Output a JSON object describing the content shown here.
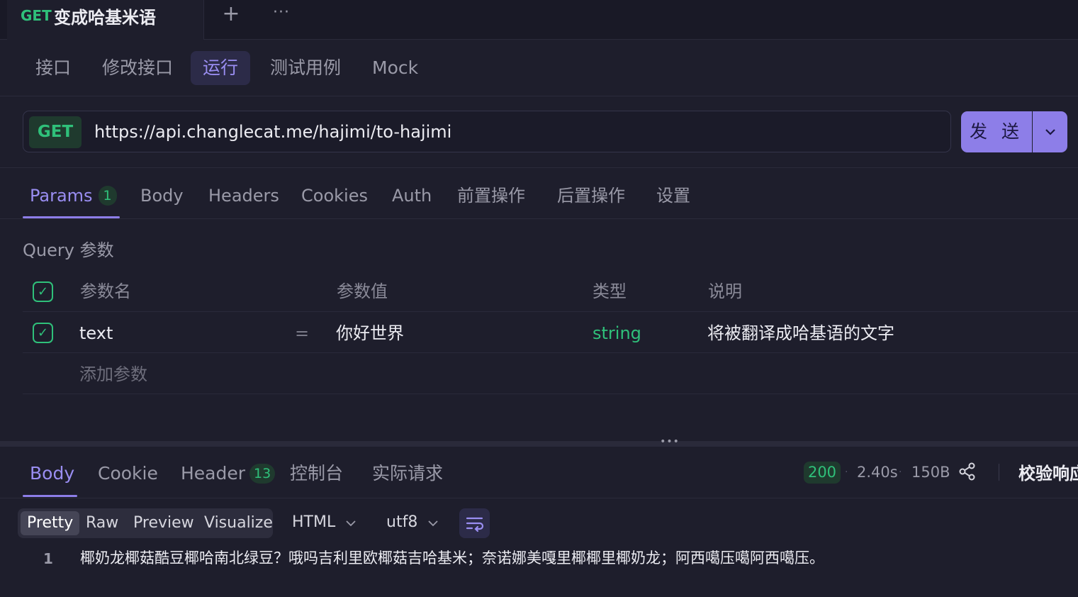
{
  "request_tab": {
    "method": "GET",
    "title": "变成哈基米语"
  },
  "sub_tabs": [
    "接口",
    "修改接口",
    "运行",
    "测试用例",
    "Mock"
  ],
  "url_bar": {
    "method": "GET",
    "url": "https://api.changlecat.me/hajimi/to-hajimi"
  },
  "send_label": "发 送",
  "param_tabs": {
    "params": "Params",
    "params_count": "1",
    "body": "Body",
    "headers": "Headers",
    "cookies": "Cookies",
    "auth": "Auth",
    "pre": "前置操作",
    "post": "后置操作",
    "settings": "设置"
  },
  "query": {
    "label": "Query 参数",
    "headers": {
      "name": "参数名",
      "value": "参数值",
      "type": "类型",
      "desc": "说明"
    },
    "rows": [
      {
        "name": "text",
        "eq": "=",
        "value": "你好世界",
        "type": "string",
        "desc": "将被翻译成哈基语的文字"
      }
    ],
    "add": "添加参数"
  },
  "response": {
    "tabs": {
      "body": "Body",
      "cookie": "Cookie",
      "header": "Header",
      "header_count": "13",
      "console": "控制台",
      "actual": "实际请求"
    },
    "status": "200",
    "time": "2.40s",
    "size": "150B",
    "validate": "校验响应"
  },
  "format": {
    "modes": [
      "Pretty",
      "Raw",
      "Preview",
      "Visualize"
    ],
    "type": "HTML",
    "encoding": "utf8"
  },
  "output": {
    "line": "1",
    "text": "椰奶龙椰菇酷豆椰哈南北绿豆？哦吗吉利里欧椰菇吉哈基米；奈诺娜美嘎里椰椰里椰奶龙；阿西噶压噶阿西噶压。"
  },
  "colors": {
    "accent": "#8d7ee8",
    "get": "#2fc07a",
    "background": "#1e1e2c"
  }
}
